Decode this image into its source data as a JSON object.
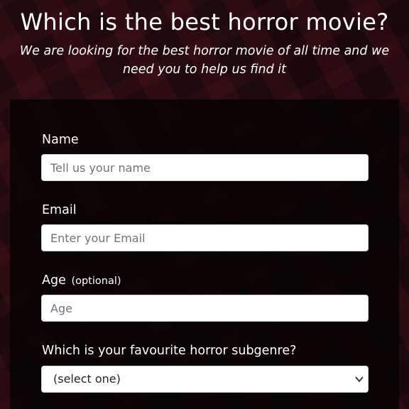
{
  "header": {
    "title": "Which is the best horror movie?",
    "description": "We are looking for the best horror movie of all time and we need you to help us find it"
  },
  "form": {
    "name": {
      "label": "Name",
      "placeholder": "Tell us your name"
    },
    "email": {
      "label": "Email",
      "placeholder": "Enter your Email"
    },
    "age": {
      "label": "Age",
      "optional": "(optional)",
      "placeholder": "Age"
    },
    "subgenre": {
      "label": "Which is your favourite horror subgenre?",
      "selected": "(select one)"
    }
  },
  "icons": {
    "select_arrow": "chevron-down-icon"
  }
}
